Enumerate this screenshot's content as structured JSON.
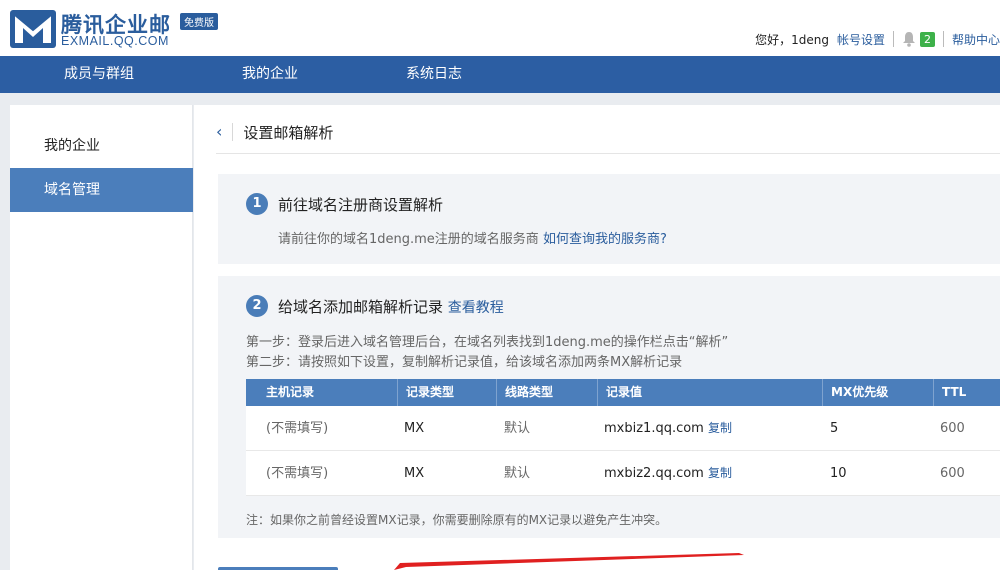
{
  "header": {
    "logo_cn": "腾讯企业邮",
    "logo_en": "EXMAIL.QQ.COM",
    "badge": "免费版",
    "greeting": "您好，1deng",
    "account_settings": "帐号设置",
    "notification_count": "2",
    "help_center": "帮助中心"
  },
  "nav": {
    "items": [
      "成员与群组",
      "我的企业",
      "系统日志"
    ]
  },
  "sidebar": {
    "items": [
      {
        "label": "我的企业",
        "active": false
      },
      {
        "label": "域名管理",
        "active": true
      }
    ]
  },
  "page": {
    "title": "设置邮箱解析"
  },
  "step1": {
    "number": "1",
    "title": "前往域名注册商设置解析",
    "desc": "请前往你的域名1deng.me注册的域名服务商",
    "link": "如何查询我的服务商?"
  },
  "step2": {
    "number": "2",
    "title": "给域名添加邮箱解析记录",
    "link": "查看教程",
    "line1": "第一步：登录后进入域名管理后台，在域名列表找到1deng.me的操作栏点击“解析”",
    "line2": "第二步：请按照如下设置，复制解析记录值，给该域名添加两条MX解析记录",
    "table": {
      "headers": [
        "主机记录",
        "记录类型",
        "线路类型",
        "记录值",
        "MX优先级",
        "TTL"
      ],
      "rows": [
        {
          "host": "(不需填写)",
          "type": "MX",
          "line": "默认",
          "value": "mxbiz1.qq.com",
          "copy": "复制",
          "priority": "5",
          "ttl": "600"
        },
        {
          "host": "(不需填写)",
          "type": "MX",
          "line": "默认",
          "value": "mxbiz2.qq.com",
          "copy": "复制",
          "priority": "10",
          "ttl": "600"
        }
      ]
    },
    "note": "注：如果你之前曾经设置MX记录，你需要删除原有的MX记录以避免产生冲突。"
  },
  "colors": {
    "brand": "#2c5ea3",
    "accent": "#4b7ebb",
    "badge_green": "#3db14a"
  }
}
